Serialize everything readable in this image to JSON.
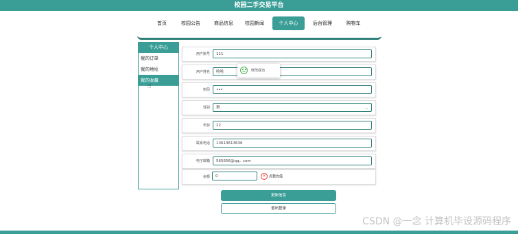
{
  "site": {
    "title": "校园二手交易平台"
  },
  "nav": [
    {
      "label": "首页",
      "active": false
    },
    {
      "label": "校园公告",
      "active": false
    },
    {
      "label": "商品信息",
      "active": false
    },
    {
      "label": "校园新闻",
      "active": false
    },
    {
      "label": "个人中心",
      "active": true
    },
    {
      "label": "后台管理",
      "active": false
    },
    {
      "label": "购物车",
      "active": false
    }
  ],
  "sidebar": {
    "header": "个人中心",
    "items": [
      {
        "label": "我的订单",
        "active": false
      },
      {
        "label": "我的地址",
        "active": false
      },
      {
        "label": "我的收藏",
        "active": true
      }
    ]
  },
  "form": {
    "username": {
      "label": "用户账号",
      "value": "111"
    },
    "fullname": {
      "label": "用户姓名",
      "value": "哈哈"
    },
    "password": {
      "label": "密码",
      "value": "•••"
    },
    "gender": {
      "label": "性别",
      "value": "男"
    },
    "age": {
      "label": "年龄",
      "value": "22"
    },
    "phone": {
      "label": "联系电话",
      "value": "13613613636"
    },
    "email": {
      "label": "电子邮箱",
      "value": "565656@qq。com"
    },
    "balance": {
      "label": "余额",
      "value": "0",
      "recharge": "点我充值"
    }
  },
  "tooltip": {
    "text": "修改成功"
  },
  "buttons": {
    "update": "更新信息",
    "logout": "退出登录"
  },
  "watermark": "CSDN @一念 计算机毕设源码程序",
  "colors": {
    "accent": "#3a9e97"
  }
}
